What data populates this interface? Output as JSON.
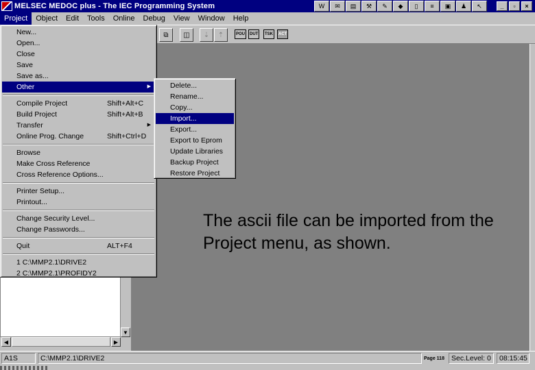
{
  "window": {
    "title": "MELSEC MEDOC plus - The IEC Programming System",
    "title_toolbar_icons": [
      "w-icon",
      "mail-icon",
      "chart-icon",
      "tools-icon",
      "paint-icon",
      "diamond-icon",
      "file-icon",
      "note-icon",
      "app-icon",
      "figure-icon",
      "pointer-icon"
    ],
    "controls": {
      "minimize": "_",
      "maximize": "▫",
      "close": "×"
    }
  },
  "menubar": {
    "items": [
      "Project",
      "Object",
      "Edit",
      "Tools",
      "Online",
      "Debug",
      "View",
      "Window",
      "Help"
    ]
  },
  "toolbar": {
    "small_buttons": [
      "POU",
      "DUT",
      "TSK",
      "ACT"
    ]
  },
  "project_menu": {
    "items": [
      {
        "label": "New...",
        "accel": ""
      },
      {
        "label": "Open...",
        "accel": ""
      },
      {
        "label": "Close",
        "accel": ""
      },
      {
        "label": "Save",
        "accel": ""
      },
      {
        "label": "Save as...",
        "accel": ""
      },
      {
        "label": "Other",
        "accel": ""
      },
      {
        "label": "Compile Project",
        "accel": "Shift+Alt+C"
      },
      {
        "label": "Build Project",
        "accel": "Shift+Alt+B"
      },
      {
        "label": "Transfer",
        "accel": ""
      },
      {
        "label": "Online Prog. Change",
        "accel": "Shift+Ctrl+D"
      },
      {
        "label": "Browse",
        "accel": ""
      },
      {
        "label": "Make Cross Reference",
        "accel": ""
      },
      {
        "label": "Cross Reference Options...",
        "accel": ""
      },
      {
        "label": "Printer Setup...",
        "accel": ""
      },
      {
        "label": "Printout...",
        "accel": ""
      },
      {
        "label": "Change Security Level...",
        "accel": ""
      },
      {
        "label": "Change Passwords...",
        "accel": ""
      },
      {
        "label": "Quit",
        "accel": "ALT+F4"
      },
      {
        "label": "1 C:\\MMP2.1\\DRIVE2",
        "accel": ""
      },
      {
        "label": "2 C:\\MMP2.1\\PROFIDY2",
        "accel": ""
      }
    ]
  },
  "other_menu": {
    "items": [
      "Delete...",
      "Rename...",
      "Copy...",
      "Import...",
      "Export...",
      "Export to Eprom",
      "Update Libraries",
      "Backup Project",
      "Restore Project"
    ]
  },
  "annotation": {
    "text": "The ascii file can be imported from the Project menu, as shown."
  },
  "statusbar": {
    "plc": "A1S",
    "path": "C:\\MMP2.1\\DRIVE2",
    "page": "Page 118",
    "security": "Sec.Level: 0",
    "time": "08:15:45"
  }
}
